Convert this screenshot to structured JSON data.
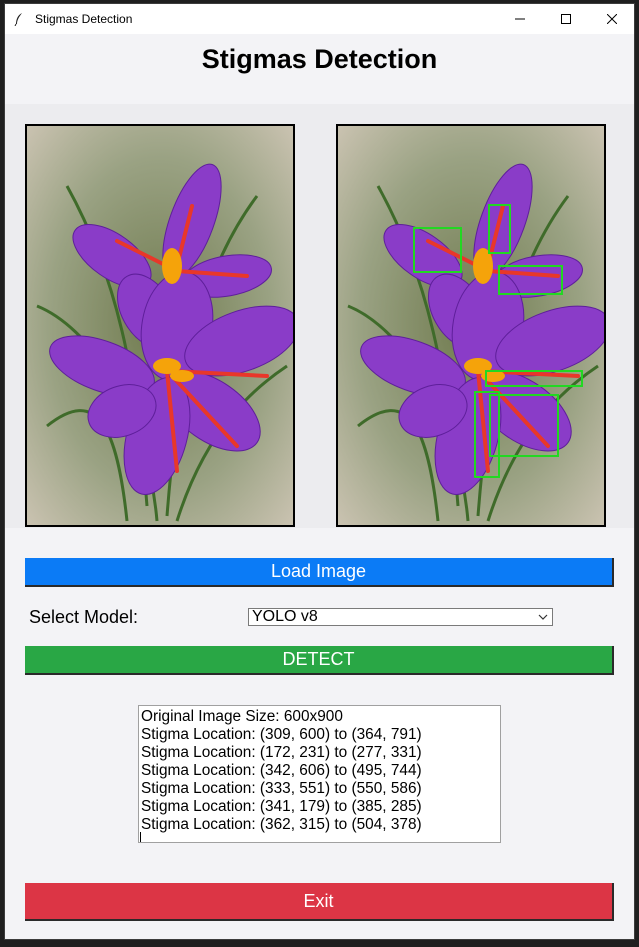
{
  "window": {
    "title": "Stigmas Detection"
  },
  "header": {
    "title": "Stigmas Detection"
  },
  "images": {
    "original": {
      "icon": "saffron-flower-image"
    },
    "detected": {
      "icon": "saffron-flower-detections-image",
      "box_color": "#22d822"
    }
  },
  "controls": {
    "load_label": "Load Image",
    "model_label": "Select Model:",
    "model_value": "YOLO v8",
    "detect_label": "DETECT",
    "exit_label": "Exit"
  },
  "output": {
    "lines": [
      "Original Image Size: 600x900",
      "Stigma Location: (309, 600) to (364, 791)",
      "Stigma Location: (172, 231) to (277, 331)",
      "Stigma Location: (342, 606) to (495, 744)",
      "Stigma Location: (333, 551) to (550, 586)",
      "Stigma Location: (341, 179) to (385, 285)",
      "Stigma Location: (362, 315) to (504, 378)"
    ]
  },
  "colors": {
    "load": "#0b7bf6",
    "detect": "#29a745",
    "exit": "#dc3545"
  }
}
